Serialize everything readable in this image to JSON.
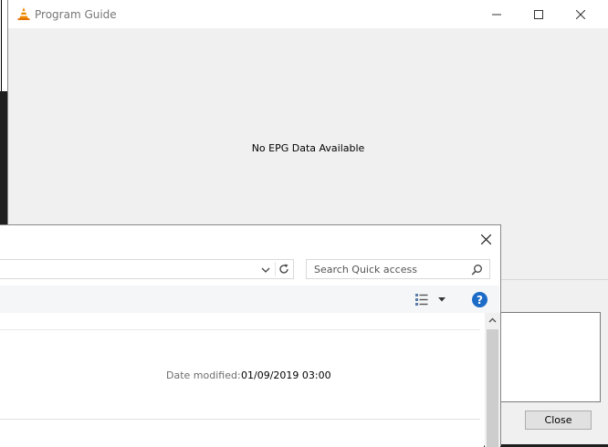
{
  "epg_window": {
    "title": "Program Guide",
    "empty_message": "No EPG Data Available",
    "close_label": "Close",
    "icons": {
      "app": "vlc-cone-icon",
      "minimize": "minimize-icon",
      "maximize": "maximize-icon",
      "close": "close-icon"
    }
  },
  "file_dialog": {
    "search": {
      "placeholder": "Search Quick access"
    },
    "details": {
      "date_label": "Date modified:",
      "date_value": "01/09/2019 03:00"
    },
    "icons": {
      "close": "close-icon",
      "dropdown": "chevron-down-icon",
      "refresh": "refresh-icon",
      "search": "search-icon",
      "view": "view-options-icon",
      "help": "help-icon"
    },
    "help_glyph": "?"
  },
  "colors": {
    "vlc_orange": "#f08a00",
    "help_blue": "#1c6bc7"
  }
}
